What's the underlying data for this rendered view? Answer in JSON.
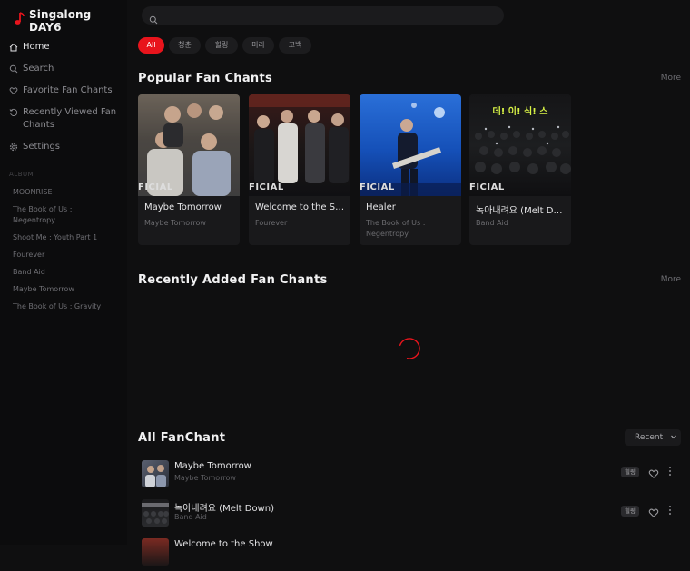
{
  "app": {
    "title": "Singalong DAY6"
  },
  "nav": [
    {
      "label": "Home",
      "icon": "home-icon",
      "active": true
    },
    {
      "label": "Search",
      "icon": "search-icon"
    },
    {
      "label": "Favorite Fan Chants",
      "icon": "heart-icon"
    },
    {
      "label": "Recently Viewed Fan Chants",
      "icon": "history-icon"
    },
    {
      "label": "Settings",
      "icon": "gear-icon"
    }
  ],
  "album": {
    "heading": "ALBUM",
    "items": [
      "MOONRISE",
      "The Book of Us : Negentropy",
      "Shoot Me : Youth Part 1",
      "Fourever",
      "Band Aid",
      "Maybe Tomorrow",
      "The Book of Us : Gravity"
    ]
  },
  "search": {
    "placeholder": ""
  },
  "chips": [
    {
      "label": "All",
      "active": true
    },
    {
      "label": "청춘"
    },
    {
      "label": "힐링"
    },
    {
      "label": "미라"
    },
    {
      "label": "고백"
    }
  ],
  "popular": {
    "title": "Popular Fan Chants",
    "more": "More",
    "cards": [
      {
        "title": "Maybe Tomorrow",
        "album": "Maybe Tomorrow",
        "thumb_text": "FICIAL"
      },
      {
        "title": "Welcome to the Show",
        "album": "Fourever",
        "thumb_text": "FICIAL"
      },
      {
        "title": "Healer",
        "album": "The Book of Us : Negentropy",
        "thumb_text": "FICIAL"
      },
      {
        "title": "녹아내려요 (Melt Down)",
        "album": "Band Aid",
        "thumb_text": "FICIAL",
        "banner": "데! 이! 식! 스"
      }
    ]
  },
  "recent": {
    "title": "Recently Added Fan Chants",
    "more": "More"
  },
  "all": {
    "title": "All FanChant",
    "sort": "Recent",
    "rows": [
      {
        "title": "Maybe Tomorrow",
        "album": "Maybe Tomorrow",
        "badge": "힐링"
      },
      {
        "title": "녹아내려요 (Melt Down)",
        "album": "Band Aid",
        "badge": "힐링"
      },
      {
        "title": "Welcome to the Show",
        "album": "",
        "badge": ""
      }
    ]
  },
  "colors": {
    "accent": "#e8141c",
    "background": "#0f0f10",
    "card": "#19191b"
  }
}
